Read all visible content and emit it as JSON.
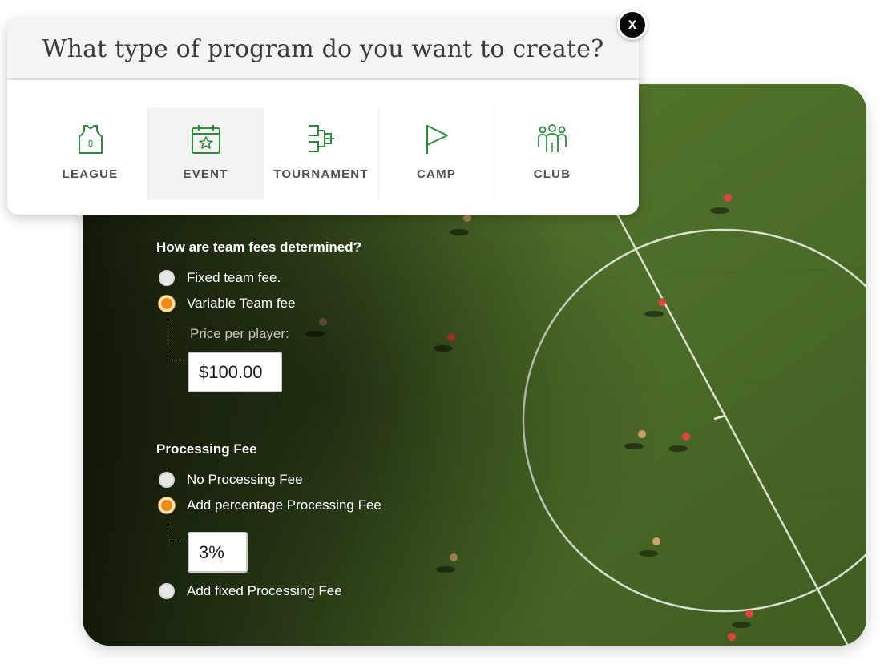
{
  "modal": {
    "title": "What type of program do you want to create?",
    "close_label": "x",
    "program_types": [
      {
        "label": "LEAGUE",
        "icon": "jersey-icon"
      },
      {
        "label": "EVENT",
        "icon": "calendar-star-icon",
        "selected": true
      },
      {
        "label": "TOURNAMENT",
        "icon": "bracket-icon"
      },
      {
        "label": "CAMP",
        "icon": "flag-icon"
      },
      {
        "label": "CLUB",
        "icon": "group-icon"
      }
    ],
    "accent_color": "#2e8b3e"
  },
  "team_fees": {
    "question": "How are team fees determined?",
    "options": [
      {
        "label": "Fixed team fee.",
        "selected": false
      },
      {
        "label": "Variable Team fee",
        "selected": true
      }
    ],
    "price_label": "Price per player:",
    "price_value": "$100.00"
  },
  "processing_fee": {
    "title": "Processing Fee",
    "options": [
      {
        "label": "No Processing Fee",
        "selected": false
      },
      {
        "label": "Add percentage Processing Fee",
        "selected": true
      },
      {
        "label": "Add fixed Processing Fee",
        "selected": false
      }
    ],
    "percentage_value": "3%"
  },
  "colors": {
    "radio_selected": "#f08a13",
    "field_green": "#4f6e2a"
  }
}
